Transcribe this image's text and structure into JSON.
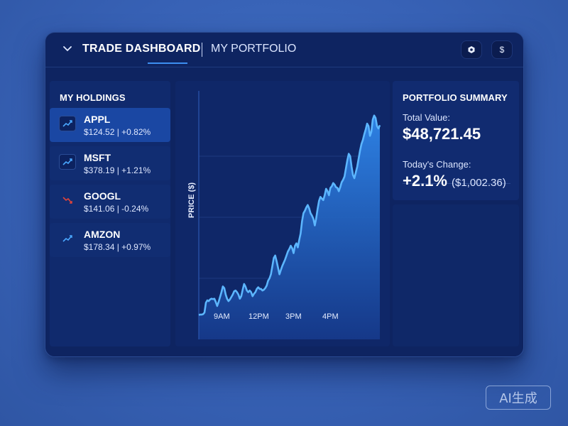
{
  "header": {
    "title": "TRADE DASHBOARD",
    "subtitle": "MY PORTFOLIO",
    "icon_buttons": [
      "settings-icon",
      "dollar-icon"
    ]
  },
  "holdings": {
    "title": "MY HOLDINGS",
    "items": [
      {
        "symbol": "APPL",
        "value": "$124.52 | +0.82%",
        "trend": "up",
        "active": true
      },
      {
        "symbol": "MSFT",
        "value": "$378.19 | +1.21%",
        "trend": "up",
        "active": false
      },
      {
        "symbol": "GOOGL",
        "value": "$141.06 | -0.24%",
        "trend": "down",
        "active": false
      },
      {
        "symbol": "AMZON",
        "value": "$178.34 | +0.97%",
        "trend": "up",
        "active": false
      }
    ]
  },
  "summary": {
    "title": "PORTFOLIO SUMMARY",
    "total_label": "Total Value:",
    "total_value": "$48,721.45",
    "change_label": "Today's Change:",
    "change_pct": "+2.1%",
    "change_abs": "($1,002.36)"
  },
  "colors": {
    "accent": "#3d8ef0",
    "up": "#4aa8ff",
    "down": "#e0443a"
  },
  "chart_data": {
    "type": "area",
    "ylabel": "PRICE ($)",
    "xlabel": "",
    "x_ticks": [
      "9AM",
      "12PM",
      "3PM",
      "4PM"
    ],
    "y": [
      30,
      30.5,
      30.4,
      31,
      33,
      45,
      48,
      47,
      49,
      50,
      49.5,
      50,
      46,
      41,
      46,
      52,
      58,
      65,
      63,
      55,
      50,
      47,
      49,
      52,
      55,
      59,
      60,
      58,
      55,
      50,
      53,
      61,
      68,
      65,
      60,
      58,
      60,
      58,
      53,
      56,
      58,
      62,
      64,
      62,
      62,
      60,
      61,
      63,
      66,
      72,
      75,
      80,
      90,
      100,
      103,
      96,
      88,
      80,
      85,
      90,
      94,
      98,
      103,
      108,
      111,
      115,
      112,
      106,
      115,
      118,
      113,
      122,
      130,
      145,
      155,
      158,
      162,
      165,
      161,
      155,
      152,
      148,
      140,
      149,
      160,
      170,
      175,
      173,
      171,
      177,
      185,
      182,
      177,
      186,
      188,
      192,
      190,
      187,
      186,
      182,
      187,
      193,
      196,
      200,
      210,
      220,
      228,
      225,
      212,
      202,
      198,
      205,
      212,
      222,
      232,
      240,
      245,
      252,
      258,
      265,
      262,
      250,
      255,
      270,
      275,
      272,
      262,
      259,
      263
    ],
    "ylim": [
      0,
      300
    ],
    "grid": true
  },
  "watermark": "AI生成"
}
